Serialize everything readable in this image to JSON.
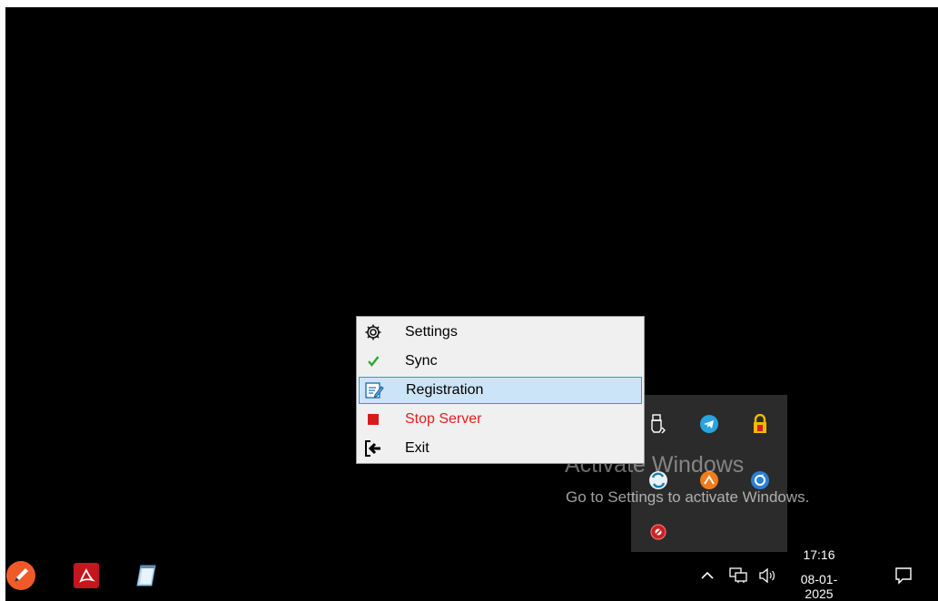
{
  "context_menu": {
    "items": [
      {
        "label": "Settings",
        "icon": "gear-icon"
      },
      {
        "label": "Sync",
        "icon": "checkmark-icon"
      },
      {
        "label": "Registration",
        "icon": "edit-form-icon",
        "highlighted": true
      },
      {
        "label": "Stop Server",
        "icon": "stop-icon",
        "color": "#e81c1c"
      },
      {
        "label": "Exit",
        "icon": "exit-icon"
      }
    ]
  },
  "watermark": {
    "title": "Activate Windows",
    "subtitle": "Go to Settings to activate Windows."
  },
  "tray_overflow": {
    "icons": [
      "usb-icon",
      "telegram-icon",
      "vpn-lock-icon",
      "sync-app-icon",
      "orange-app-icon",
      "blue-app-icon",
      "red-app-icon"
    ]
  },
  "taskbar": {
    "apps": [
      "pen-app-icon",
      "pdf-reader-icon",
      "notepad-icon"
    ],
    "clock": {
      "time": "17:16",
      "date": "08-01-2025"
    },
    "system_icons": [
      "chevron-up-icon",
      "network-icon",
      "volume-icon",
      "notification-icon"
    ]
  },
  "colors": {
    "menu_background": "#f0f0f0",
    "highlight": "#cce4f7",
    "highlight_border": "#26a0da",
    "danger": "#e81c1c",
    "desktop": "#000000"
  }
}
